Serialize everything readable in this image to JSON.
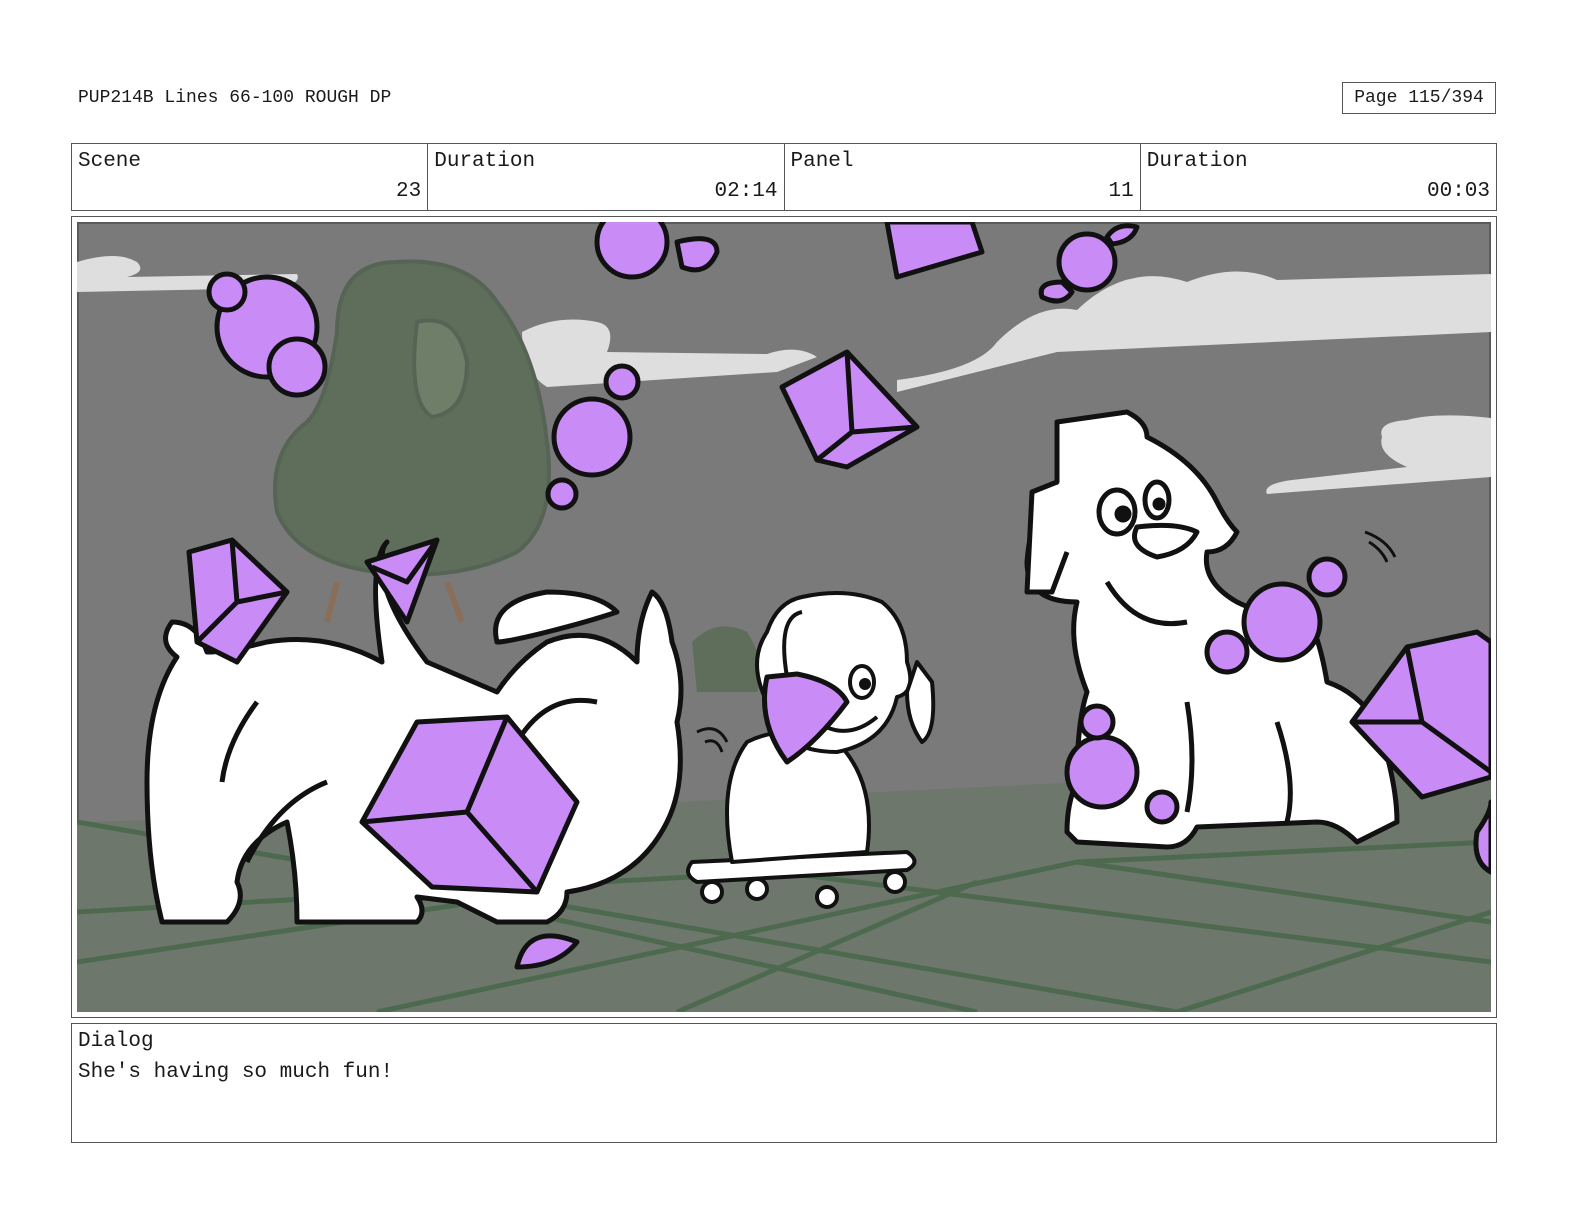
{
  "header": {
    "title": "PUP214B Lines 66-100 ROUGH DP",
    "page": "Page 115/394"
  },
  "info": {
    "scene_label": "Scene",
    "scene_value": "23",
    "scene_duration_label": "Duration",
    "scene_duration_value": "02:14",
    "panel_label": "Panel",
    "panel_value": "11",
    "panel_duration_label": "Duration",
    "panel_duration_value": "00:03"
  },
  "dialog": {
    "label": "Dialog",
    "text": "She's having so much fun!"
  },
  "panel_image": {
    "colors": {
      "sky": "#7a7a7a",
      "cloud": "#dedede",
      "tree": "#5f6e5a",
      "floor": "#6e776c",
      "grid": "#4d6a4f",
      "treat": "#c98cf7",
      "outline": "#111111",
      "pup": "#ffffff"
    }
  }
}
